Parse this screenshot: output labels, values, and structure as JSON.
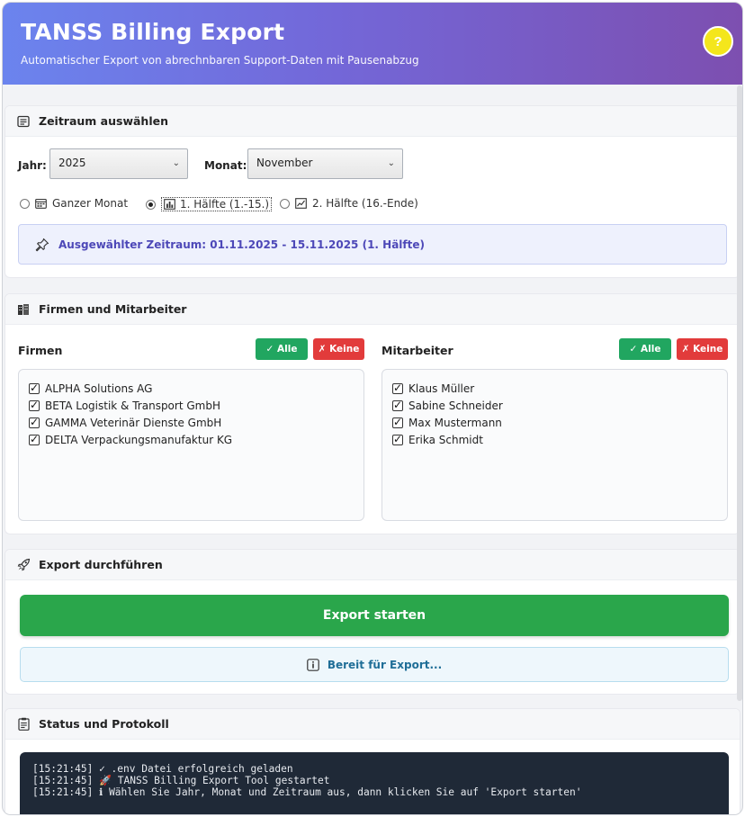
{
  "header": {
    "title": "TANSS Billing Export",
    "subtitle": "Automatischer Export von abrechnbaren Support-Daten mit Pausenabzug",
    "help_label": "?"
  },
  "period": {
    "section_title": "Zeitraum auswählen",
    "year_label": "Jahr:",
    "year_value": "2025",
    "month_label": "Monat:",
    "month_value": "November",
    "options": [
      {
        "label": "Ganzer Monat",
        "icon": "calendar-icon",
        "selected": false
      },
      {
        "label": "1. Hälfte (1.-15.)",
        "icon": "bar-chart-icon",
        "selected": true
      },
      {
        "label": "2. Hälfte (16.-Ende)",
        "icon": "line-chart-icon",
        "selected": false
      }
    ],
    "selected_text": "Ausgewählter Zeitraum: 01.11.2025 - 15.11.2025 (1. Hälfte)"
  },
  "companies": {
    "section_title": "Firmen und Mitarbeiter",
    "firms_title": "Firmen",
    "employees_title": "Mitarbeiter",
    "all_label": "✓ Alle",
    "none_label": "✗ Keine",
    "firms": [
      "ALPHA Solutions AG",
      "BETA Logistik & Transport GmbH",
      "GAMMA Veterinär Dienste GmbH",
      "DELTA Verpackungsmanufaktur KG"
    ],
    "employees": [
      "Klaus Müller",
      "Sabine Schneider",
      "Max Mustermann",
      "Erika Schmidt"
    ]
  },
  "export": {
    "section_title": "Export durchführen",
    "button_label": "Export starten",
    "status_text": "Bereit für Export..."
  },
  "log": {
    "section_title": "Status und Protokoll",
    "lines": [
      "[15:21:45] ✓ .env Datei erfolgreich geladen",
      "[15:21:45] 🚀 TANSS Billing Export Tool gestartet",
      "[15:21:45] ℹ Wählen Sie Jahr, Monat und Zeitraum aus, dann klicken Sie auf 'Export starten'"
    ]
  },
  "colors": {
    "header_start": "#6b84ee",
    "header_end": "#7d4fb0",
    "accent": "#5b4fc7",
    "success": "#2aa64b",
    "danger": "#e23b3b",
    "console_bg": "#1f2937"
  }
}
